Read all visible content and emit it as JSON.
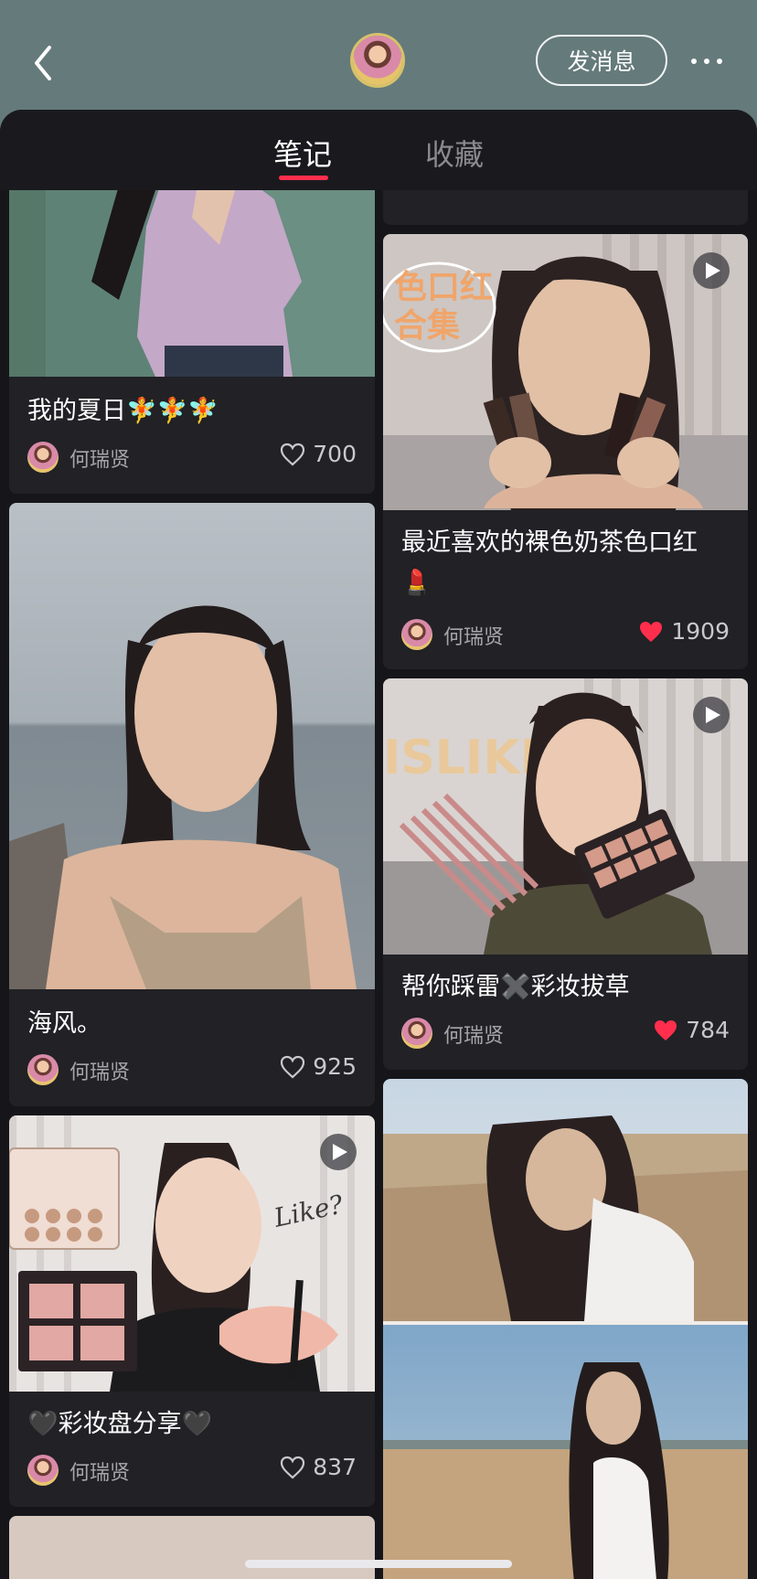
{
  "header": {
    "message_button": "发消息"
  },
  "tabs": [
    {
      "label": "笔记",
      "active": true
    },
    {
      "label": "收藏",
      "active": false
    }
  ],
  "accent_color": "#ff2e4d",
  "notes": [
    {
      "title": "我的夏日🧚🧚🧚",
      "author": "何瑞贤",
      "likes": "700",
      "liked": false,
      "video": false
    },
    {
      "title": "海风。",
      "author": "何瑞贤",
      "likes": "925",
      "liked": false,
      "video": false
    },
    {
      "title": "🖤彩妆盘分享🖤",
      "author": "何瑞贤",
      "likes": "837",
      "liked": false,
      "video": true
    },
    {
      "title_line1": "最近喜欢的裸色奶茶色口红",
      "title_line2": "💄",
      "author": "何瑞贤",
      "likes": "1909",
      "liked": true,
      "video": true
    },
    {
      "title": "帮你踩雷✖️彩妆拔草",
      "author": "何瑞贤",
      "likes": "784",
      "liked": true,
      "video": true
    }
  ],
  "image_text": {
    "lipstick_banner_line1": "色口红",
    "lipstick_banner_line2": "合集",
    "palette_banner": "ISLIKE",
    "like_sticker": "Like?"
  }
}
